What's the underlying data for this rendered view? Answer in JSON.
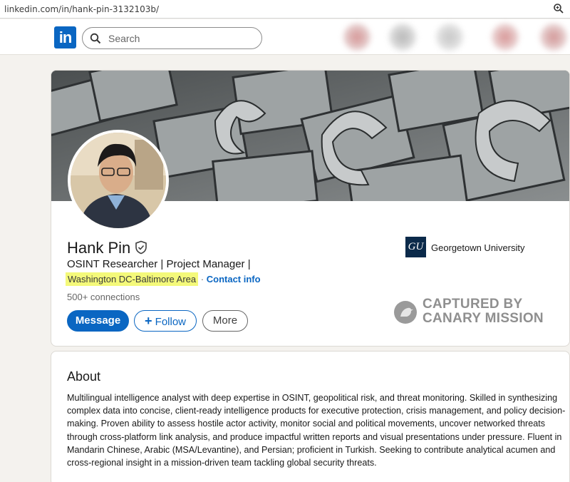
{
  "browser": {
    "url": "linkedin.com/in/hank-pin-3132103b/"
  },
  "nav": {
    "logo_text": "in",
    "search_placeholder": "Search"
  },
  "profile": {
    "name": "Hank Pin",
    "headline": "OSINT Researcher | Project Manager |",
    "location": "Washington DC-Baltimore Area",
    "separator": "·",
    "contact_label": "Contact info",
    "connections": "500+ connections",
    "buttons": {
      "message": "Message",
      "follow": "Follow",
      "follow_icon": "+",
      "more": "More"
    },
    "education": {
      "logo_text": "GU",
      "name": "Georgetown University"
    },
    "stamp": {
      "line1": "CAPTURED BY",
      "line2": "CANARY MISSION"
    }
  },
  "about": {
    "title": "About",
    "text": "Multilingual intelligence analyst with deep expertise in OSINT, geopolitical risk, and threat monitoring. Skilled in synthesizing complex data into concise, client-ready intelligence products for executive protection, crisis management, and policy decision-making. Proven ability to assess hostile actor activity, monitor social and political movements, uncover networked threats through cross-platform link analysis, and produce impactful written reports and visual presentations under pressure. Fluent in Mandarin Chinese, Arabic (MSA/Levantine), and Persian; proficient in Turkish. Seeking to contribute analytical acumen and cross-regional insight in a mission-driven team tackling global security threats."
  },
  "colors": {
    "brand": "#0a66c2",
    "highlight": "#f4f97a"
  },
  "icons": [
    "search-icon",
    "verified-shield-icon",
    "zoom-icon",
    "canary-bird-icon"
  ]
}
